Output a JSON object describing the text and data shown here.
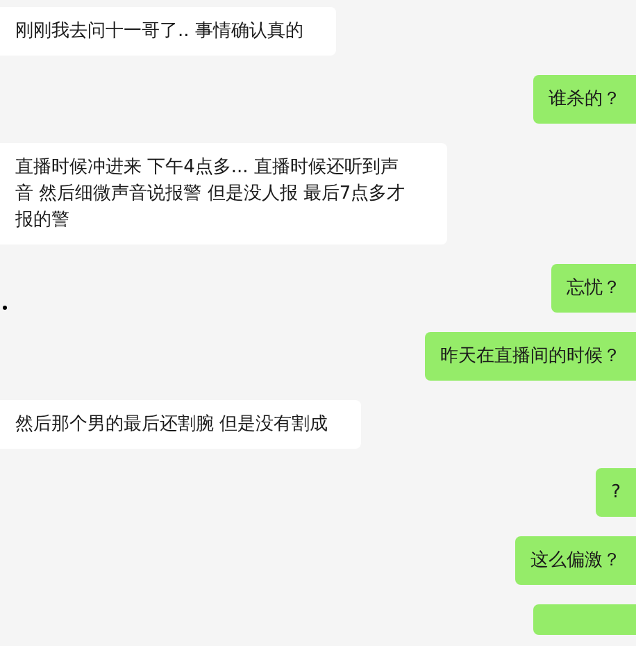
{
  "messages": [
    {
      "kind": "text",
      "outgoing": false,
      "text": "刚刚我去问十一哥了.. 事情确认真的"
    },
    {
      "kind": "text",
      "outgoing": true,
      "text": "谁杀的？"
    },
    {
      "kind": "text",
      "outgoing": false,
      "text": "直播时候冲进来 下午4点多... 直播时候还听到声音 然后细微声音说报警 但是没人报 最后7点多才报的警"
    },
    {
      "kind": "text",
      "outgoing": true,
      "text": "忘忧？"
    },
    {
      "kind": "dot",
      "outgoing": false
    },
    {
      "kind": "text",
      "outgoing": true,
      "text": "昨天在直播间的时候？"
    },
    {
      "kind": "text",
      "outgoing": false,
      "text": "然后那个男的最后还割腕 但是没有割成"
    },
    {
      "kind": "text",
      "outgoing": true,
      "text": "?"
    },
    {
      "kind": "text",
      "outgoing": true,
      "text": "这么偏激？"
    },
    {
      "kind": "partial",
      "outgoing": true
    }
  ]
}
